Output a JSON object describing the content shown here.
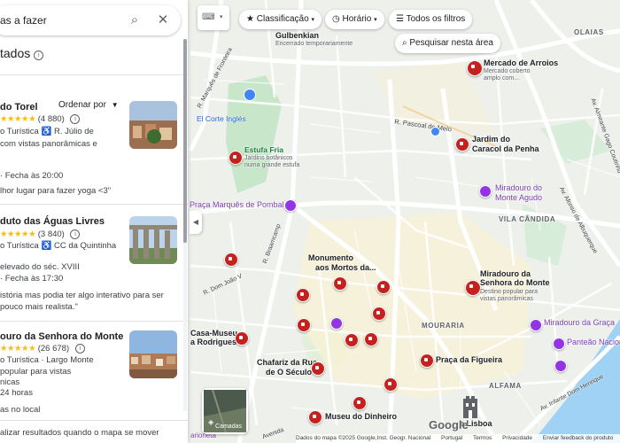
{
  "search": {
    "query": "as a fazer"
  },
  "panel": {
    "results_title": "tados",
    "sort_label": "Ordenar por",
    "results": [
      {
        "name": "do Torel",
        "rating": "4,5",
        "reviews": "(4 880)",
        "category": "o Turística",
        "address": "R. Júlio de",
        "desc1": "com vistas panorâmicas e",
        "hours": "· Fecha às 20:00",
        "review": "lhor lugar para fazer yoga <3\""
      },
      {
        "name": "duto das Águas Livres",
        "rating": "4,6",
        "reviews": "(3 840)",
        "category": "o Turística",
        "address": "CC da Quintinha",
        "desc1": "elevado do séc. XVIII",
        "hours": "· Fecha às 17:30",
        "review1": "istória mas podia ter algo interativo para ser",
        "review2": "pouco mais realista.\""
      },
      {
        "name": "ouro da Senhora do Monte",
        "rating": "4,7",
        "reviews": "(26 678)",
        "category": "o Turística · Largo Monte",
        "desc1": "popular para vistas",
        "desc2": "nicas",
        "hours": "24 horas",
        "extra": "as no local"
      }
    ],
    "bottom_text": "alizar resultados quando o mapa se mover"
  },
  "chips": {
    "classificacao": "Classificação",
    "horario": "Horário",
    "filtros": "Todos os filtros",
    "search_area": "Pesquisar nesta área"
  },
  "map": {
    "labels": {
      "gulbenkian": "Gulbenkian",
      "gulbenkian_sub": "Encerrado temporariamente",
      "olaias": "OLAIAS",
      "mercado_arroios": "Mercado de Arroios",
      "mercado_arroios_sub1": "Mercado coberto",
      "mercado_arroios_sub2": "amplo com...",
      "corte_ingles": "El Corte Inglés",
      "pascoal": "R. Pascoal de Melo",
      "jardim_caracol1": "Jardim do",
      "jardim_caracol2": "Caracol da Penha",
      "estufa_fria": "Estufa Fria",
      "estufa_sub1": "Jardins botânicos",
      "estufa_sub2": "numa grande estufa",
      "miradouro_agudo1": "Miradouro do",
      "miradouro_agudo2": "Monte Agudo",
      "praca_pombal": "Praça Marquês de Pombal",
      "vila_candida": "VILA CÂNDIDA",
      "monumento1": "Monumento",
      "monumento2": "aos Mortos da...",
      "miradouro_senhora1": "Miradouro da",
      "miradouro_senhora2": "Senhora do Monte",
      "miradouro_senhora_sub1": "Destino popular para",
      "miradouro_senhora_sub2": "vistas panorâmicas",
      "mouraria": "MOURARIA",
      "miradouro_graca": "Miradouro da Graça",
      "casa_museu1": "Casa-Museu",
      "casa_museu2": "a Rodrigues",
      "panteao": "Panteão Naciona",
      "chafariz1": "Chafariz da Rua",
      "chafariz2": "de O Século",
      "praca_figueira": "Praça da Figueira",
      "alfama": "ALFAMA",
      "museu_dinheiro": "Museu do Dinheiro",
      "lisboa": "e Lisboa",
      "marques_fronteira": "R. Marquês de Fronteira",
      "braamcamp": "R. Braamcamp",
      "dom_joao": "R. Dom João V",
      "av_almirante": "Av. Almirante Gago Coutinho",
      "av_albuquerque": "Av. Afonso de Albuquerque",
      "av_infante": "Av. Infante Dom Henrique",
      "avenida_bottom": "Avenida",
      "marioneta": "arioneta"
    },
    "layers_label": "Camadas",
    "google": "Google",
    "footer": [
      "Dados do mapa ©2025 Google,Inst. Geogr. Nacional",
      "Portugal",
      "Termos",
      "Privacidade",
      "Enviar feedback do produto",
      "500"
    ]
  },
  "colors": {
    "pin_red": "#c5221f",
    "star": "#fbbc04",
    "park": "#c8e6c9",
    "water": "#9fd2f5"
  }
}
